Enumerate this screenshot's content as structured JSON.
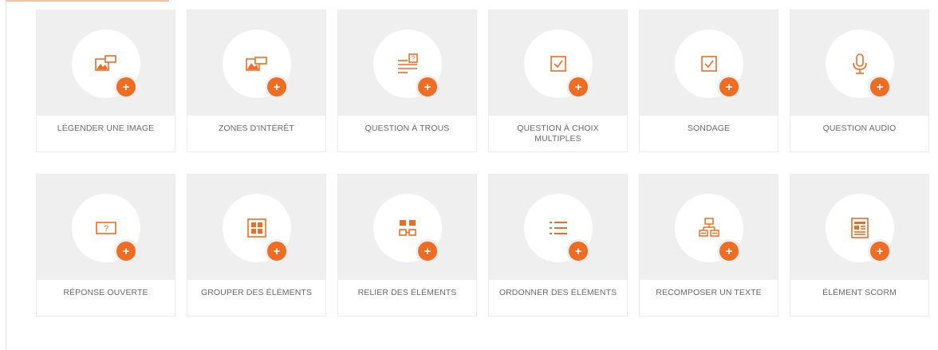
{
  "accent_color": "#ef6c23",
  "tiles": [
    {
      "label": "LÉGENDER UNE IMAGE",
      "icon": "image-caption-icon"
    },
    {
      "label": "ZONES D'INTÉRÊT",
      "icon": "image-zones-icon"
    },
    {
      "label": "QUESTION À TROUS",
      "icon": "fill-blanks-icon"
    },
    {
      "label": "QUESTION À CHOIX MULTIPLES",
      "icon": "checkbox-icon"
    },
    {
      "label": "SONDAGE",
      "icon": "checkbox-icon"
    },
    {
      "label": "QUESTION AUDIO",
      "icon": "microphone-icon"
    },
    {
      "label": "RÉPONSE OUVERTE",
      "icon": "question-box-icon"
    },
    {
      "label": "GROUPER DES ÉLÉMENTS",
      "icon": "group-grid-icon"
    },
    {
      "label": "RELIER DES ÉLÉMENTS",
      "icon": "link-blocks-icon"
    },
    {
      "label": "ORDONNER DES ÉLÉMENTS",
      "icon": "ordered-list-icon"
    },
    {
      "label": "RECOMPOSER UN TEXTE",
      "icon": "recompose-text-icon"
    },
    {
      "label": "ÉLÉMENT SCORM",
      "icon": "scorm-document-icon"
    }
  ]
}
